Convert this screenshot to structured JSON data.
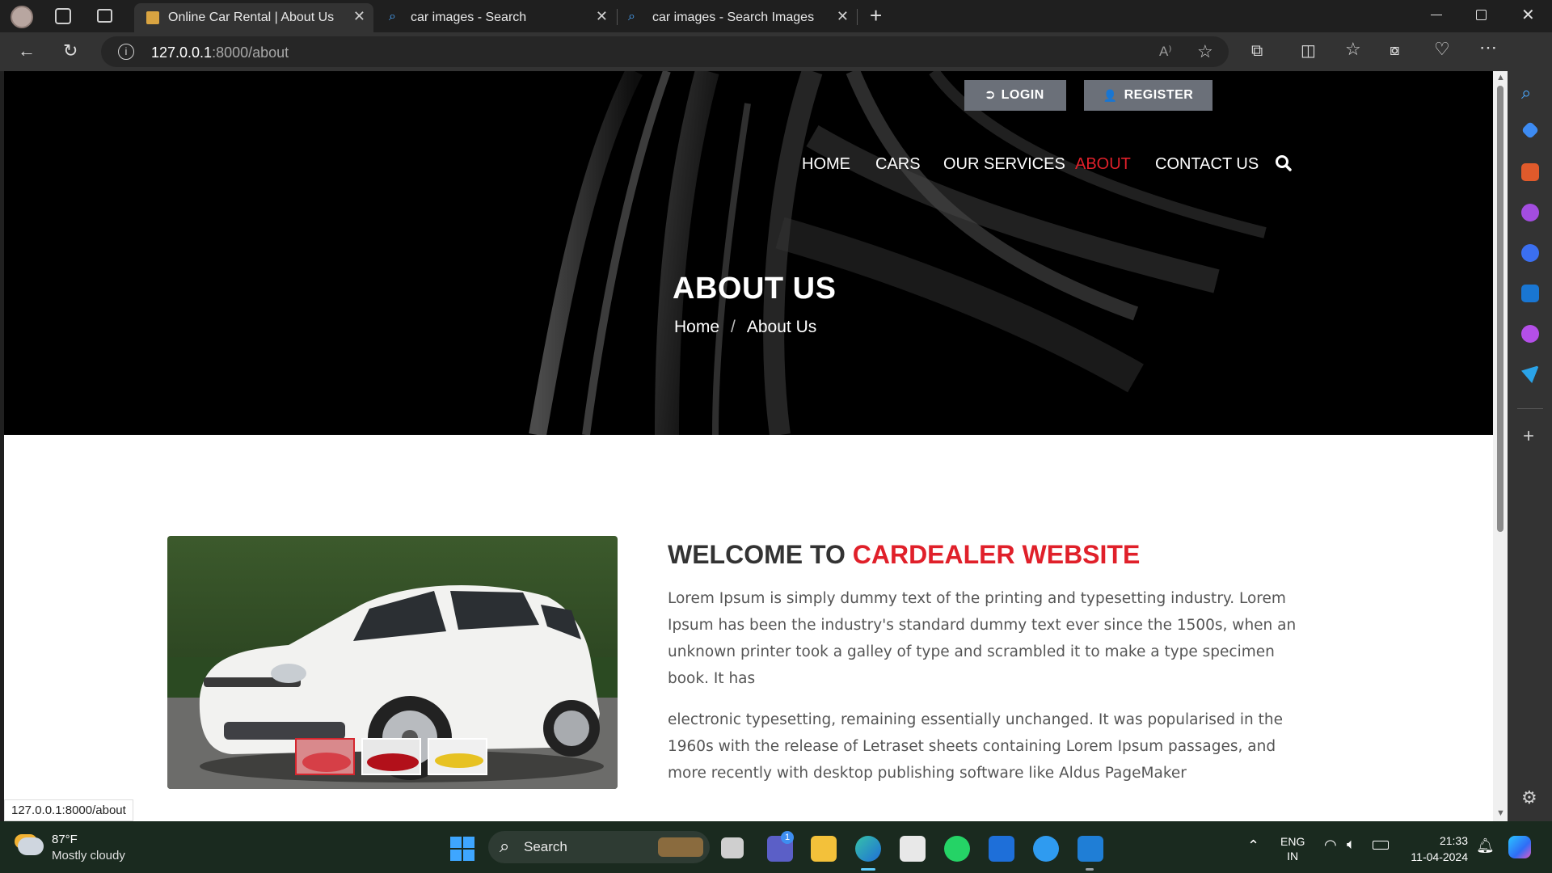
{
  "browser": {
    "tabs": [
      {
        "title": "Online Car Rental | About Us",
        "active": true
      },
      {
        "title": "car images - Search",
        "active": false
      },
      {
        "title": "car images - Search Images",
        "active": false
      }
    ],
    "url_host": "127.0.0.1",
    "url_path": ":8000/about",
    "status_url": "127.0.0.1:8000/about"
  },
  "site": {
    "auth": {
      "login": "LOGIN",
      "register": "REGISTER"
    },
    "nav": [
      {
        "label": "HOME",
        "active": false
      },
      {
        "label": "CARS",
        "active": false
      },
      {
        "label": "OUR SERVICES",
        "active": false
      },
      {
        "label": "ABOUT",
        "active": true
      },
      {
        "label": "CONTACT US",
        "active": false
      }
    ],
    "hero": {
      "title": "ABOUT US",
      "breadcrumb": {
        "home": "Home",
        "separator": "/",
        "current": "About Us"
      }
    },
    "about": {
      "heading_prefix": "WELCOME TO ",
      "heading_accent": "CARDEALER WEBSITE",
      "paragraph1": "Lorem Ipsum is simply dummy text of the printing and typesetting industry. Lorem Ipsum has been the industry's standard dummy text ever since the 1500s, when an unknown printer took a galley of type and scrambled it to make a type specimen book. It has",
      "paragraph2": "electronic typesetting, remaining essentially unchanged. It was popularised in the 1960s with the release of Letraset sheets containing Lorem Ipsum passages, and more recently with desktop publishing software like Aldus PageMaker"
    }
  },
  "taskbar": {
    "weather_temp": "87°F",
    "weather_desc": "Mostly cloudy",
    "search_label": "Search",
    "lang_line1": "ENG",
    "lang_line2": "IN",
    "time": "21:33",
    "date": "11-04-2024",
    "teams_badge": "1"
  },
  "colors": {
    "accent_red": "#e0202a",
    "button_gray": "#6b7079"
  }
}
